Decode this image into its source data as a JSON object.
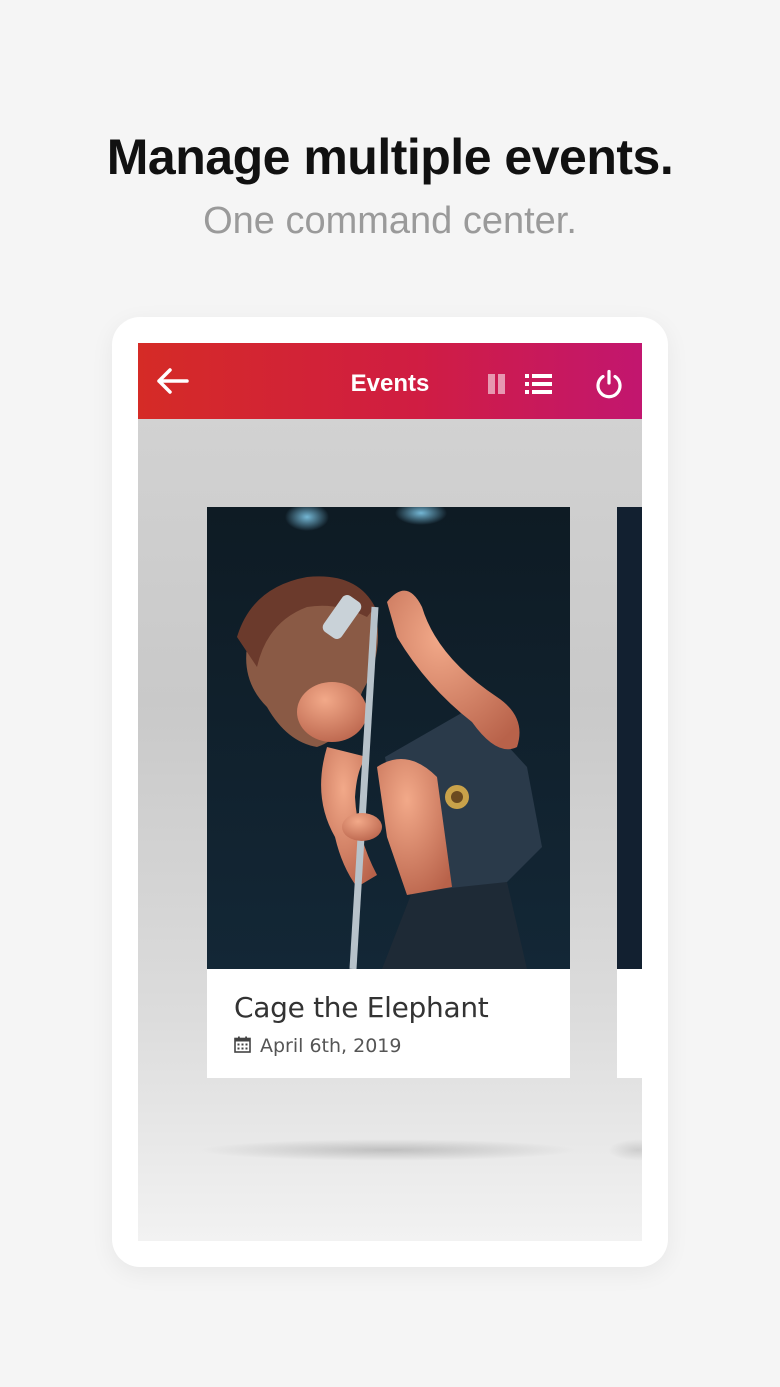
{
  "promo": {
    "headline": "Manage multiple events.",
    "subline": "One command center."
  },
  "appbar": {
    "title": "Events",
    "back_icon": "arrow-left-icon",
    "grid_icon": "grid-view-icon",
    "list_icon": "list-view-icon",
    "power_icon": "power-icon",
    "gradient_colors": [
      "#d52b26",
      "#d01d42",
      "#c2166f"
    ]
  },
  "events": [
    {
      "title": "Cage the Elephant",
      "date": "April 6th, 2019",
      "date_icon": "calendar-icon",
      "image_icon": "concert-photo"
    }
  ],
  "colors": {
    "background": "#f5f5f5",
    "headline": "#111111",
    "subline": "#9a9a9a"
  }
}
